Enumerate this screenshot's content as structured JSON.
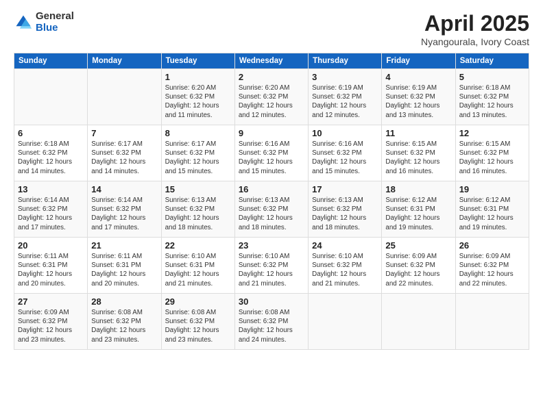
{
  "logo": {
    "general": "General",
    "blue": "Blue"
  },
  "header": {
    "title": "April 2025",
    "subtitle": "Nyangourala, Ivory Coast"
  },
  "weekdays": [
    "Sunday",
    "Monday",
    "Tuesday",
    "Wednesday",
    "Thursday",
    "Friday",
    "Saturday"
  ],
  "weeks": [
    [
      {
        "day": "",
        "info": ""
      },
      {
        "day": "",
        "info": ""
      },
      {
        "day": "1",
        "info": "Sunrise: 6:20 AM\nSunset: 6:32 PM\nDaylight: 12 hours and 11 minutes."
      },
      {
        "day": "2",
        "info": "Sunrise: 6:20 AM\nSunset: 6:32 PM\nDaylight: 12 hours and 12 minutes."
      },
      {
        "day": "3",
        "info": "Sunrise: 6:19 AM\nSunset: 6:32 PM\nDaylight: 12 hours and 12 minutes."
      },
      {
        "day": "4",
        "info": "Sunrise: 6:19 AM\nSunset: 6:32 PM\nDaylight: 12 hours and 13 minutes."
      },
      {
        "day": "5",
        "info": "Sunrise: 6:18 AM\nSunset: 6:32 PM\nDaylight: 12 hours and 13 minutes."
      }
    ],
    [
      {
        "day": "6",
        "info": "Sunrise: 6:18 AM\nSunset: 6:32 PM\nDaylight: 12 hours and 14 minutes."
      },
      {
        "day": "7",
        "info": "Sunrise: 6:17 AM\nSunset: 6:32 PM\nDaylight: 12 hours and 14 minutes."
      },
      {
        "day": "8",
        "info": "Sunrise: 6:17 AM\nSunset: 6:32 PM\nDaylight: 12 hours and 15 minutes."
      },
      {
        "day": "9",
        "info": "Sunrise: 6:16 AM\nSunset: 6:32 PM\nDaylight: 12 hours and 15 minutes."
      },
      {
        "day": "10",
        "info": "Sunrise: 6:16 AM\nSunset: 6:32 PM\nDaylight: 12 hours and 15 minutes."
      },
      {
        "day": "11",
        "info": "Sunrise: 6:15 AM\nSunset: 6:32 PM\nDaylight: 12 hours and 16 minutes."
      },
      {
        "day": "12",
        "info": "Sunrise: 6:15 AM\nSunset: 6:32 PM\nDaylight: 12 hours and 16 minutes."
      }
    ],
    [
      {
        "day": "13",
        "info": "Sunrise: 6:14 AM\nSunset: 6:32 PM\nDaylight: 12 hours and 17 minutes."
      },
      {
        "day": "14",
        "info": "Sunrise: 6:14 AM\nSunset: 6:32 PM\nDaylight: 12 hours and 17 minutes."
      },
      {
        "day": "15",
        "info": "Sunrise: 6:13 AM\nSunset: 6:32 PM\nDaylight: 12 hours and 18 minutes."
      },
      {
        "day": "16",
        "info": "Sunrise: 6:13 AM\nSunset: 6:32 PM\nDaylight: 12 hours and 18 minutes."
      },
      {
        "day": "17",
        "info": "Sunrise: 6:13 AM\nSunset: 6:32 PM\nDaylight: 12 hours and 18 minutes."
      },
      {
        "day": "18",
        "info": "Sunrise: 6:12 AM\nSunset: 6:31 PM\nDaylight: 12 hours and 19 minutes."
      },
      {
        "day": "19",
        "info": "Sunrise: 6:12 AM\nSunset: 6:31 PM\nDaylight: 12 hours and 19 minutes."
      }
    ],
    [
      {
        "day": "20",
        "info": "Sunrise: 6:11 AM\nSunset: 6:31 PM\nDaylight: 12 hours and 20 minutes."
      },
      {
        "day": "21",
        "info": "Sunrise: 6:11 AM\nSunset: 6:31 PM\nDaylight: 12 hours and 20 minutes."
      },
      {
        "day": "22",
        "info": "Sunrise: 6:10 AM\nSunset: 6:31 PM\nDaylight: 12 hours and 21 minutes."
      },
      {
        "day": "23",
        "info": "Sunrise: 6:10 AM\nSunset: 6:32 PM\nDaylight: 12 hours and 21 minutes."
      },
      {
        "day": "24",
        "info": "Sunrise: 6:10 AM\nSunset: 6:32 PM\nDaylight: 12 hours and 21 minutes."
      },
      {
        "day": "25",
        "info": "Sunrise: 6:09 AM\nSunset: 6:32 PM\nDaylight: 12 hours and 22 minutes."
      },
      {
        "day": "26",
        "info": "Sunrise: 6:09 AM\nSunset: 6:32 PM\nDaylight: 12 hours and 22 minutes."
      }
    ],
    [
      {
        "day": "27",
        "info": "Sunrise: 6:09 AM\nSunset: 6:32 PM\nDaylight: 12 hours and 23 minutes."
      },
      {
        "day": "28",
        "info": "Sunrise: 6:08 AM\nSunset: 6:32 PM\nDaylight: 12 hours and 23 minutes."
      },
      {
        "day": "29",
        "info": "Sunrise: 6:08 AM\nSunset: 6:32 PM\nDaylight: 12 hours and 23 minutes."
      },
      {
        "day": "30",
        "info": "Sunrise: 6:08 AM\nSunset: 6:32 PM\nDaylight: 12 hours and 24 minutes."
      },
      {
        "day": "",
        "info": ""
      },
      {
        "day": "",
        "info": ""
      },
      {
        "day": "",
        "info": ""
      }
    ]
  ]
}
